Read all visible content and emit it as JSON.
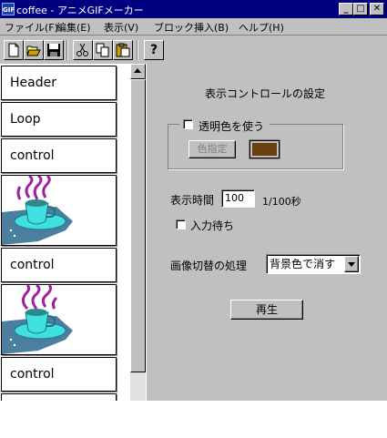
{
  "window": {
    "app_icon_text": "GIF",
    "title": "coffee - アニメGIFメーカー",
    "minimize_glyph": "_",
    "maximize_glyph": "□",
    "close_glyph": "✕"
  },
  "menu": [
    "ファイル(F)",
    "編集(E)",
    "表示(V)",
    "ブロック挿入(B)",
    "ヘルプ(H)"
  ],
  "toolbar": {
    "icons": [
      "new-file-icon",
      "open-folder-icon",
      "save-icon",
      "cut-icon",
      "copy-icon",
      "paste-icon",
      "help-icon"
    ],
    "help_glyph": "?"
  },
  "blocks": [
    "Header",
    "Loop",
    "control",
    "coffee-image",
    "control",
    "coffee-image",
    "control"
  ],
  "settings": {
    "heading": "表示コントロールの設定",
    "transparent_label": "透明色を使う",
    "transparent_checked": false,
    "color_button": "色指定",
    "color_swatch": "#6b3f10",
    "display_time_label": "表示時間",
    "display_time_value": "100",
    "display_time_unit": "1/100秒",
    "wait_input_label": "入力待ち",
    "wait_input_checked": false,
    "switch_label": "画像切替の処理",
    "switch_value": "背景色で消す",
    "play_button": "再生"
  }
}
